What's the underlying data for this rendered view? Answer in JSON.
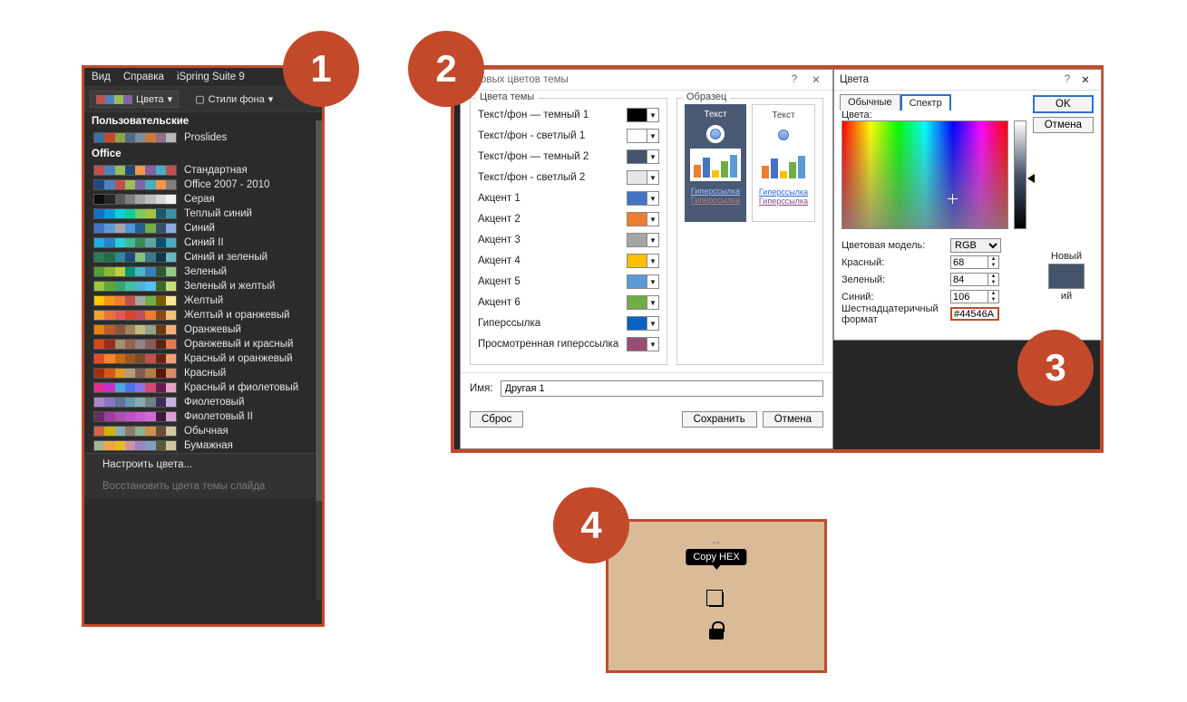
{
  "badges": {
    "n1": "1",
    "n2": "2",
    "n3": "3",
    "n4": "4"
  },
  "panel1": {
    "menubar": {
      "view": "Вид",
      "help": "Справка",
      "ispring": "iSpring Suite 9"
    },
    "toolbar": {
      "colors": "Цвета",
      "bg_styles": "Стили фона"
    },
    "sections": {
      "user": "Пользовательские",
      "office": "Office"
    },
    "user_items": [
      {
        "label": "Proslides",
        "strip": [
          "#3f6ea5",
          "#c24a2b",
          "#8fa34a",
          "#4f6b84",
          "#7a8c9e",
          "#c97a3e",
          "#926e8a",
          "#b8b8b8"
        ]
      }
    ],
    "office_items": [
      {
        "label": "Стандартная",
        "strip": [
          "#c0504d",
          "#4f81bd",
          "#9bbb59",
          "#1f497d",
          "#f79646",
          "#8064a2",
          "#4bacc6",
          "#c0504d"
        ]
      },
      {
        "label": "Office 2007 - 2010",
        "strip": [
          "#1f497d",
          "#4f81bd",
          "#c0504d",
          "#9bbb59",
          "#8064a2",
          "#4bacc6",
          "#f79646",
          "#7f7f7f"
        ]
      },
      {
        "label": "Серая",
        "strip": [
          "#0d0d0d",
          "#262626",
          "#595959",
          "#7f7f7f",
          "#a6a6a6",
          "#bfbfbf",
          "#d9d9d9",
          "#f2f2f2"
        ]
      },
      {
        "label": "Теплый синий",
        "strip": [
          "#0f6fc6",
          "#009dd9",
          "#0bd0d9",
          "#10cf9b",
          "#7cca62",
          "#a5c249",
          "#1f5766",
          "#3b93a7"
        ]
      },
      {
        "label": "Синий",
        "strip": [
          "#4472c4",
          "#5b9bd5",
          "#a5a5a5",
          "#4e95d9",
          "#255e91",
          "#70ad47",
          "#3b4d6b",
          "#8faadc"
        ]
      },
      {
        "label": "Синий II",
        "strip": [
          "#1cade4",
          "#2683c6",
          "#27ced7",
          "#42ba97",
          "#3e8853",
          "#62a39f",
          "#0b4e70",
          "#4ba8c6"
        ]
      },
      {
        "label": "Синий и зеленый",
        "strip": [
          "#2c7a51",
          "#1f6e43",
          "#31859c",
          "#1f497d",
          "#84c183",
          "#3a7a8b",
          "#0e3846",
          "#6bb7c4"
        ]
      },
      {
        "label": "Зеленый",
        "strip": [
          "#549e39",
          "#8ab833",
          "#c0cf3a",
          "#029676",
          "#4ab5c4",
          "#377eb8",
          "#2e5731",
          "#91c788"
        ]
      },
      {
        "label": "Зеленый и желтый",
        "strip": [
          "#99cb38",
          "#63a537",
          "#37a76f",
          "#44c1a3",
          "#4eb3cf",
          "#51c3f9",
          "#3b6a2a",
          "#c5e07a"
        ]
      },
      {
        "label": "Желтый",
        "strip": [
          "#ffca08",
          "#f8931d",
          "#ed7d31",
          "#c0504d",
          "#a5a5a5",
          "#70ad47",
          "#7a5c00",
          "#ffe699"
        ]
      },
      {
        "label": "Желтый и оранжевый",
        "strip": [
          "#f0a22e",
          "#e8743b",
          "#e15759",
          "#d8452c",
          "#c44d58",
          "#ed7d31",
          "#8a4a16",
          "#f8c27a"
        ]
      },
      {
        "label": "Оранжевый",
        "strip": [
          "#e48312",
          "#bd582c",
          "#865640",
          "#9b8357",
          "#c2bc80",
          "#94a088",
          "#6a3b12",
          "#f0b27a"
        ]
      },
      {
        "label": "Оранжевый и красный",
        "strip": [
          "#d34817",
          "#9b2d1f",
          "#a28e6a",
          "#956251",
          "#918485",
          "#855d5d",
          "#5a2412",
          "#e07a4a"
        ]
      },
      {
        "label": "Красный и оранжевый",
        "strip": [
          "#e84c22",
          "#ff8427",
          "#cc6a14",
          "#9b5a1f",
          "#7a4a2e",
          "#c0504d",
          "#6a2412",
          "#f2a072"
        ]
      },
      {
        "label": "Красный",
        "strip": [
          "#a5300f",
          "#d55816",
          "#e19825",
          "#b19c7d",
          "#7f5f52",
          "#b27d49",
          "#5a1608",
          "#d88a6a"
        ]
      },
      {
        "label": "Красный и фиолетовый",
        "strip": [
          "#e32d91",
          "#c830cc",
          "#4ea6dc",
          "#4775e7",
          "#8971e1",
          "#d54773",
          "#6a1a4a",
          "#e8a2c8"
        ]
      },
      {
        "label": "Фиолетовый",
        "strip": [
          "#ad84c6",
          "#8874c1",
          "#5d739a",
          "#6997af",
          "#84acb6",
          "#6f8183",
          "#3e2a5a",
          "#c8b2e0"
        ]
      },
      {
        "label": "Фиолетовый II",
        "strip": [
          "#632e62",
          "#9d3d9c",
          "#ae4db0",
          "#c04fca",
          "#cb59d0",
          "#d06bd6",
          "#3a1a3a",
          "#d8a2d8"
        ]
      },
      {
        "label": "Обычная",
        "strip": [
          "#d16349",
          "#ccb400",
          "#8cadae",
          "#8c7b70",
          "#8fb08c",
          "#d19049",
          "#6a4a3a",
          "#d0c8a0"
        ]
      },
      {
        "label": "Бумажная",
        "strip": [
          "#a5b592",
          "#f3a447",
          "#e7bc29",
          "#d092a7",
          "#9c85c0",
          "#809ec2",
          "#5a5a3a",
          "#d0c8a0"
        ]
      }
    ],
    "bottom": {
      "customize": "Настроить цвета...",
      "restore": "Восстановить цвета темы слайда"
    }
  },
  "dlg_theme": {
    "title": "е новых цветов темы",
    "group_left": "Цвета темы",
    "group_right": "Образец",
    "rows": [
      {
        "label": "Текст/фон — темный 1",
        "color": "#000000"
      },
      {
        "label": "Текст/фон - светлый 1",
        "color": "#ffffff"
      },
      {
        "label": "Текст/фон — темный 2",
        "color": "#44546a"
      },
      {
        "label": "Текст/фон - светлый 2",
        "color": "#e7e6e6"
      },
      {
        "label": "Акцент 1",
        "color": "#4472c4"
      },
      {
        "label": "Акцент 2",
        "color": "#ed7d31"
      },
      {
        "label": "Акцент 3",
        "color": "#a5a5a5"
      },
      {
        "label": "Акцент 4",
        "color": "#ffc000"
      },
      {
        "label": "Акцент 5",
        "color": "#5b9bd5"
      },
      {
        "label": "Акцент 6",
        "color": "#70ad47"
      },
      {
        "label": "Гиперссылка",
        "color": "#0563c1"
      },
      {
        "label": "Просмотренная гиперссылка",
        "color": "#954f72"
      }
    ],
    "preview": {
      "text": "Текст",
      "hyper": "Гиперссылка",
      "visited": "Гиперссылка"
    },
    "name_label": "Имя:",
    "name_value": "Другая 1",
    "reset": "Сброс",
    "save": "Сохранить",
    "cancel": "Отмена"
  },
  "dlg_colors": {
    "title": "Цвета",
    "tab_standard": "Обычные",
    "tab_spectrum": "Спектр",
    "ok": "OK",
    "cancel": "Отмена",
    "colors_label": "Цвета:",
    "model_label": "Цветовая модель:",
    "model_value": "RGB",
    "red_label": "Красный:",
    "red_value": "68",
    "green_label": "Зеленый:",
    "green_value": "84",
    "blue_label": "Синий:",
    "blue_value": "106",
    "hex_label": "Шестнадцатеричный формат",
    "hex_value": "#44546A",
    "new_label": "Новый",
    "old_label": "ий"
  },
  "panel4": {
    "tooltip": "Copy HEX",
    "resize": "↔"
  }
}
